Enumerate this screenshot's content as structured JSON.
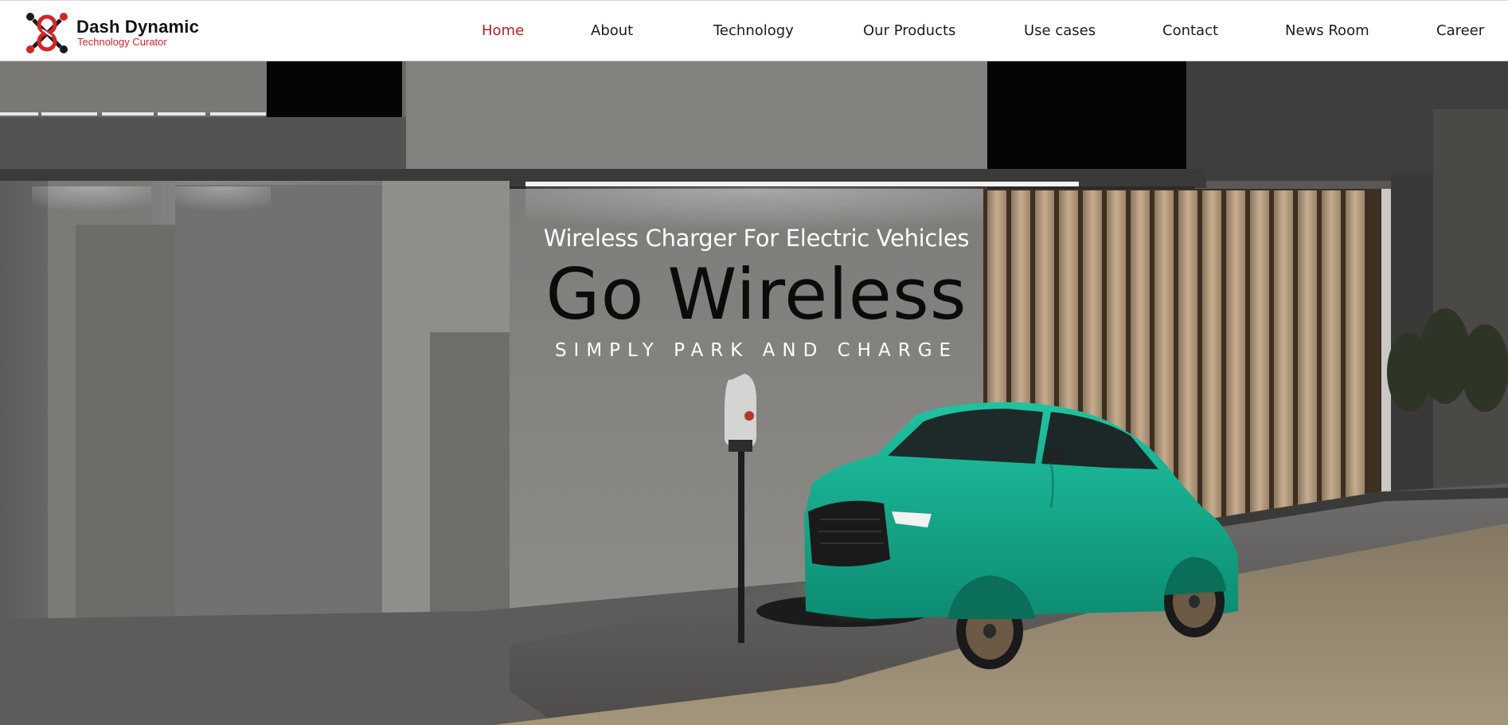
{
  "brand": {
    "name": "Dash Dynamic",
    "tagline": "Technology Curator",
    "logo_icon": "dash-dynamic-logo-icon",
    "colors": {
      "red": "#d3242a",
      "dark": "#1a1a1a"
    }
  },
  "nav": {
    "items": [
      {
        "label": "Home",
        "active": true
      },
      {
        "label": "About",
        "active": false
      },
      {
        "label": "Technology",
        "active": false
      },
      {
        "label": "Our Products",
        "active": false
      },
      {
        "label": "Use cases",
        "active": false
      },
      {
        "label": "Contact",
        "active": false
      },
      {
        "label": "News Room",
        "active": false
      },
      {
        "label": "Career",
        "active": false
      }
    ],
    "active_color": "#b51d22"
  },
  "hero": {
    "kicker": "Wireless Charger For Electric Vehicles",
    "title": "Go Wireless",
    "tagline": "SIMPLY PARK AND CHARGE",
    "scene": "Teal electric SUV parked on wireless charging pad beside a wall-mounted charger in a concrete garage at night",
    "car_color": "#17a88a",
    "charging_glow_color": "#3bd14a"
  }
}
